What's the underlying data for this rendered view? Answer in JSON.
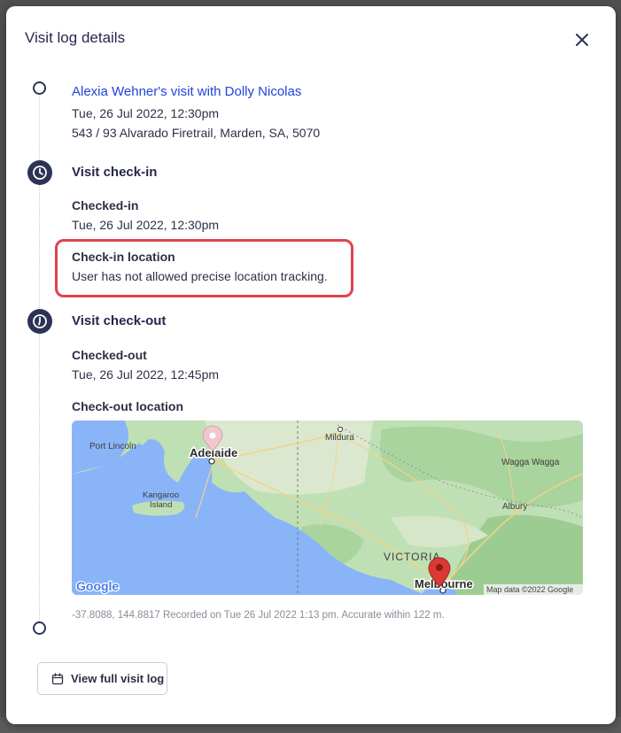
{
  "modal": {
    "title": "Visit log details",
    "close_icon": "close-icon"
  },
  "visit": {
    "title": "Alexia Wehner's visit with Dolly Nicolas",
    "datetime": "Tue, 26 Jul 2022, 12:30pm",
    "address": "543 / 93 Alvarado Firetrail, Marden, SA, 5070"
  },
  "check_in": {
    "heading": "Visit check-in",
    "checked_label": "Checked-in",
    "checked_value": "Tue, 26 Jul 2022, 12:30pm",
    "location_label": "Check-in location",
    "location_value": "User has not allowed precise location tracking."
  },
  "check_out": {
    "heading": "Visit check-out",
    "checked_label": "Checked-out",
    "checked_value": "Tue, 26 Jul 2022, 12:45pm",
    "location_label": "Check-out location"
  },
  "map": {
    "labels": {
      "port_lincoln": "Port Lincoln",
      "adelaide": "Adelaide",
      "mildura": "Mildura",
      "wagga": "Wagga Wagga",
      "kangaroo1": "Kangaroo",
      "kangaroo2": "Island",
      "albury": "Albury",
      "victoria": "VICTORIA",
      "melbourne": "Melbourne",
      "google": "Google",
      "attribution": "Map data ©2022 Google"
    },
    "colors": {
      "water": "#8ab4f8",
      "land": "#bfe0b5",
      "pin": "#d93a35"
    }
  },
  "recorded": "-37.8088, 144.8817 Recorded on Tue 26 Jul 2022 1:13 pm. Accurate within 122 m.",
  "footer": {
    "view_button": "View full visit log",
    "view_icon": "calendar-icon"
  }
}
